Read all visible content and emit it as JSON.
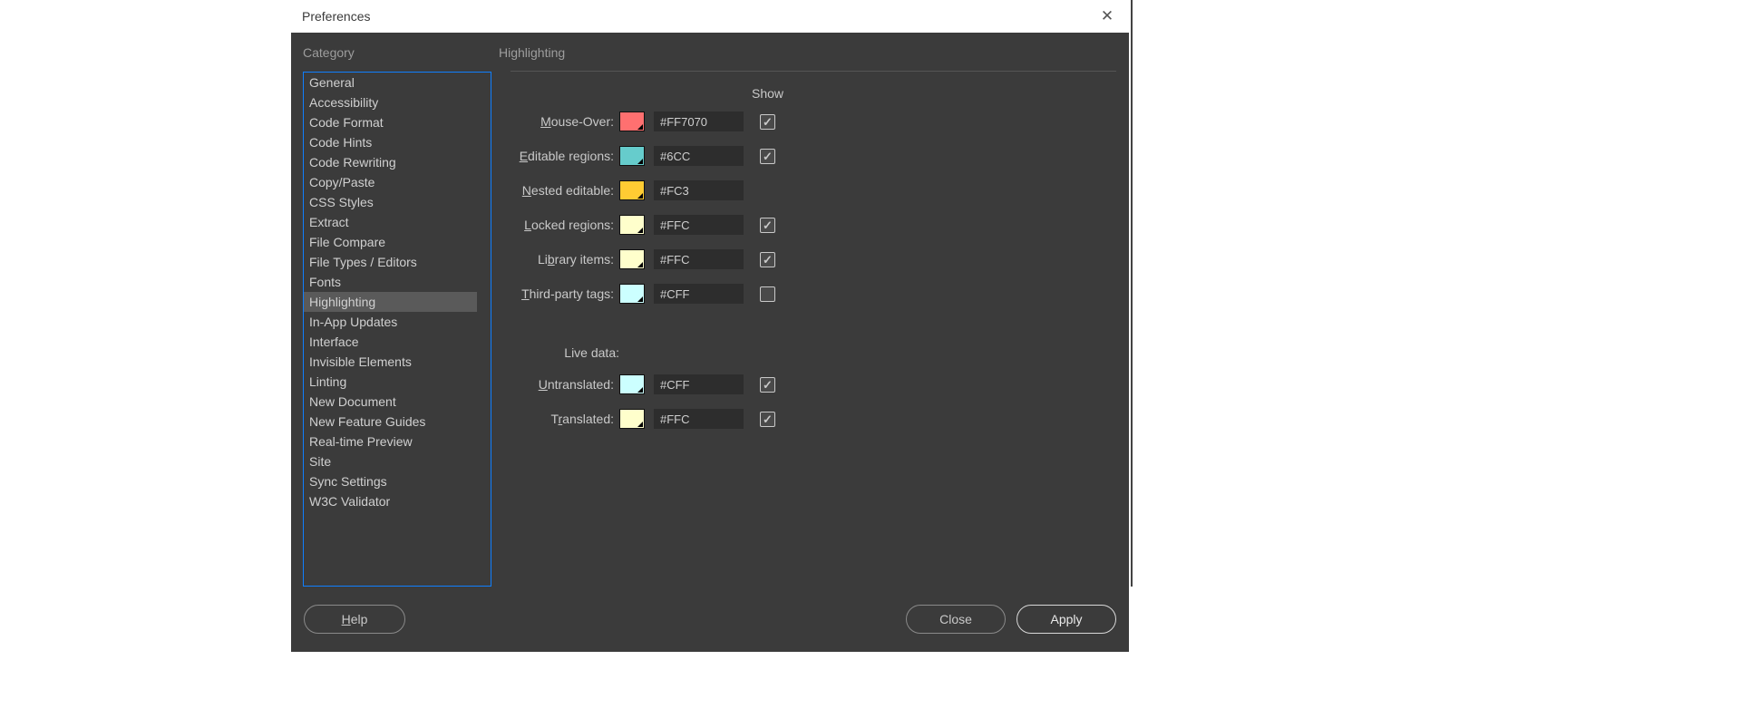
{
  "window": {
    "title": "Preferences"
  },
  "headers": {
    "category": "Category",
    "panel": "Highlighting"
  },
  "categories": [
    "General",
    "Accessibility",
    "Code Format",
    "Code Hints",
    "Code Rewriting",
    "Copy/Paste",
    "CSS Styles",
    "Extract",
    "File Compare",
    "File Types / Editors",
    "Fonts",
    "Highlighting",
    "In-App Updates",
    "Interface",
    "Invisible Elements",
    "Linting",
    "New Document",
    "New Feature Guides",
    "Real-time Preview",
    "Site",
    "Sync Settings",
    "W3C Validator"
  ],
  "selectedCategory": "Highlighting",
  "panel": {
    "showLabel": "Show",
    "rows": [
      {
        "id": "mouse-over",
        "labelPre": "",
        "ul": "M",
        "labelPost": "ouse-Over:",
        "hex": "#FF7070",
        "color": "#FF7070",
        "hasCheck": true,
        "checked": true
      },
      {
        "id": "editable-regions",
        "labelPre": "",
        "ul": "E",
        "labelPost": "ditable regions:",
        "hex": "#6CC",
        "color": "#66CCCC",
        "hasCheck": true,
        "checked": true
      },
      {
        "id": "nested-editable",
        "labelPre": "",
        "ul": "N",
        "labelPost": "ested editable:",
        "hex": "#FC3",
        "color": "#FFCC33",
        "hasCheck": false,
        "checked": false
      },
      {
        "id": "locked-regions",
        "labelPre": "",
        "ul": "L",
        "labelPost": "ocked regions:",
        "hex": "#FFC",
        "color": "#FFFFCC",
        "hasCheck": true,
        "checked": true
      },
      {
        "id": "library-items",
        "labelPre": "Li",
        "ul": "b",
        "labelPost": "rary items:",
        "hex": "#FFC",
        "color": "#FFFFCC",
        "hasCheck": true,
        "checked": true
      },
      {
        "id": "third-party-tags",
        "labelPre": "",
        "ul": "T",
        "labelPost": "hird-party tags:",
        "hex": "#CFF",
        "color": "#CCFFFF",
        "hasCheck": true,
        "checked": false
      }
    ],
    "liveData": {
      "label": "Live data:",
      "rows": [
        {
          "id": "untranslated",
          "labelPre": "",
          "ul": "U",
          "labelPost": "ntranslated:",
          "hex": "#CFF",
          "color": "#CCFFFF",
          "hasCheck": true,
          "checked": true
        },
        {
          "id": "translated",
          "labelPre": "T",
          "ul": "r",
          "labelPost": "anslated:",
          "hex": "#FFC",
          "color": "#FFFFCC",
          "hasCheck": true,
          "checked": true
        }
      ]
    }
  },
  "buttons": {
    "help": {
      "pre": "",
      "ul": "H",
      "post": "elp"
    },
    "close": "Close",
    "apply": "Apply"
  }
}
